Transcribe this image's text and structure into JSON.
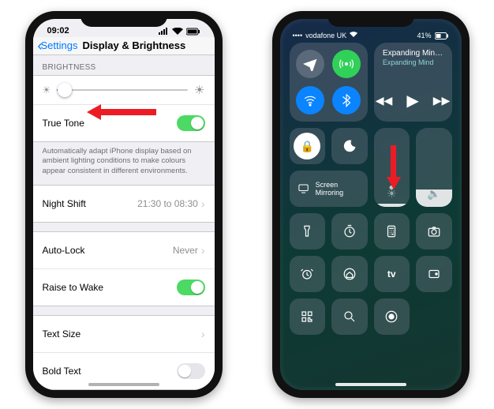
{
  "left": {
    "status": {
      "time": "09:02"
    },
    "nav": {
      "back": "Settings",
      "title": "Display & Brightness"
    },
    "brightness": {
      "header": "BRIGHTNESS",
      "slider_percent": 6,
      "truetone_label": "True Tone",
      "truetone_on": true,
      "truetone_desc": "Automatically adapt iPhone display based on ambient lighting conditions to make colours appear consistent in different environments."
    },
    "nightshift": {
      "label": "Night Shift",
      "value": "21:30 to 08:30"
    },
    "autolock": {
      "label": "Auto-Lock",
      "value": "Never"
    },
    "raise": {
      "label": "Raise to Wake",
      "on": true
    },
    "textsize": {
      "label": "Text Size"
    },
    "boldtext": {
      "label": "Bold Text",
      "on": false
    }
  },
  "right": {
    "status": {
      "carrier": "vodafone UK",
      "battery": "41%"
    },
    "music": {
      "title": "Expanding Min…",
      "subtitle": "Expanding Mind"
    },
    "mirror_label": "Screen Mirroring",
    "brightness_percent": 4,
    "volume_percent": 22,
    "connectivity": {
      "airplane_on": false,
      "cellular_on": true,
      "wifi_on": true,
      "bluetooth_on": true
    }
  }
}
